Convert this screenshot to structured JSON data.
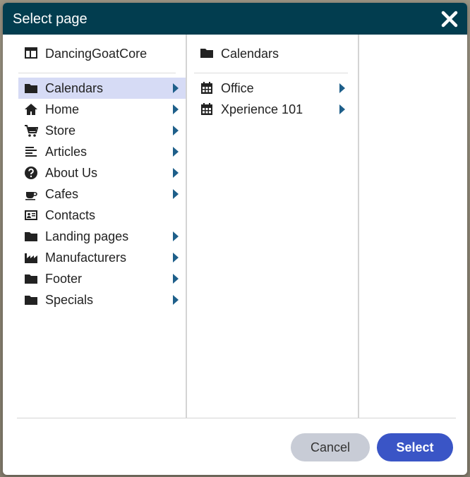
{
  "dialog": {
    "title": "Select page",
    "cancel_label": "Cancel",
    "select_label": "Select"
  },
  "column1": {
    "root": {
      "label": "DancingGoatCore",
      "icon": "layout-icon"
    },
    "items": [
      {
        "label": "Calendars",
        "icon": "folder-icon",
        "has_children": true,
        "selected": true
      },
      {
        "label": "Home",
        "icon": "home-icon",
        "has_children": true
      },
      {
        "label": "Store",
        "icon": "cart-icon",
        "has_children": true
      },
      {
        "label": "Articles",
        "icon": "article-icon",
        "has_children": true
      },
      {
        "label": "About Us",
        "icon": "question-icon",
        "has_children": true
      },
      {
        "label": "Cafes",
        "icon": "cup-icon",
        "has_children": true
      },
      {
        "label": "Contacts",
        "icon": "contact-card-icon",
        "has_children": false
      },
      {
        "label": "Landing pages",
        "icon": "folder-icon",
        "has_children": true
      },
      {
        "label": "Manufacturers",
        "icon": "factory-icon",
        "has_children": true
      },
      {
        "label": "Footer",
        "icon": "folder-icon",
        "has_children": true
      },
      {
        "label": "Specials",
        "icon": "folder-icon",
        "has_children": true
      }
    ]
  },
  "column2": {
    "header": {
      "label": "Calendars",
      "icon": "folder-icon"
    },
    "items": [
      {
        "label": "Office",
        "icon": "calendar-icon",
        "has_children": true
      },
      {
        "label": "Xperience 101",
        "icon": "calendar-icon",
        "has_children": true
      }
    ]
  },
  "colors": {
    "titlebar": "#023d4f",
    "selected_row": "#d6dbf5",
    "select_button": "#3a55c6",
    "cancel_button": "#c8ccd6",
    "arrow": "#1e5f8a"
  }
}
